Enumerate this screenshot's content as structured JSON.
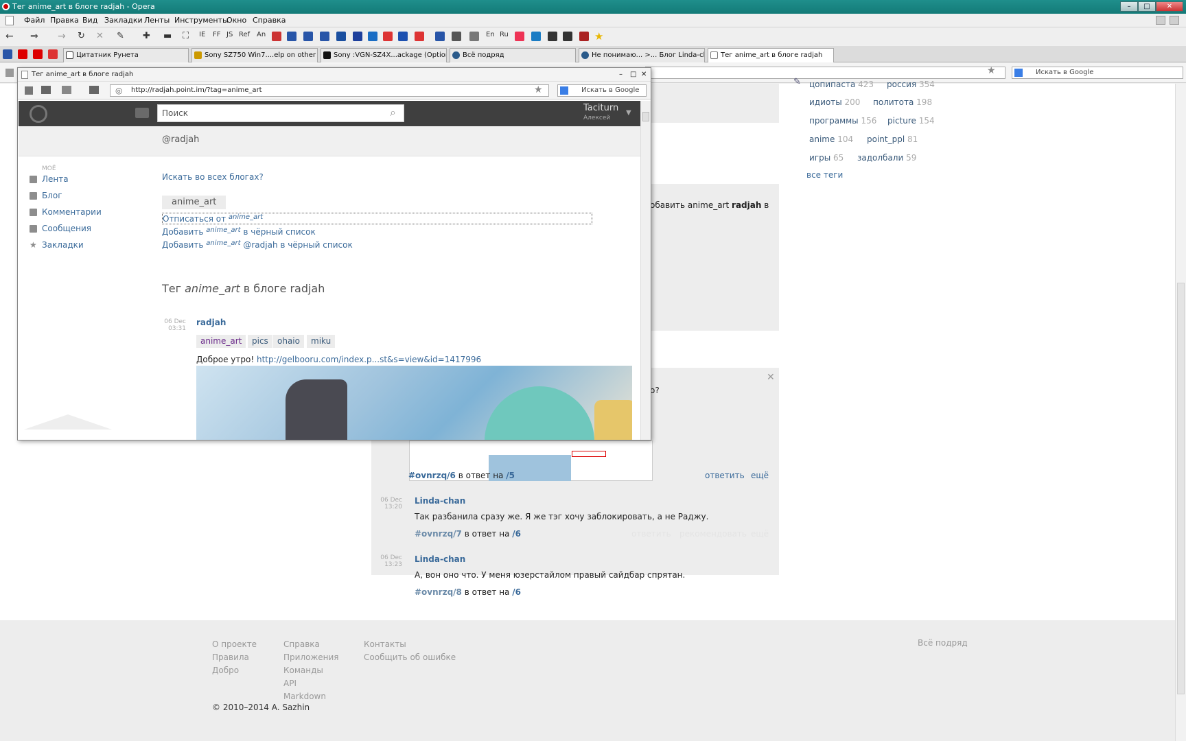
{
  "window": {
    "title": "Тег anime_art в блоге radjah - Opera"
  },
  "menu": [
    "Файл",
    "Правка",
    "Вид",
    "Закладки",
    "Ленты",
    "Инструменты",
    "Окно",
    "Справка"
  ],
  "toolbar": {
    "labels": [
      "IE",
      "FF",
      "JS",
      "Ref",
      "An",
      "En",
      "Ru"
    ]
  },
  "tabs": [
    {
      "label": "Цитатник Рунета"
    },
    {
      "label": "Sony SZ750 Win7....elp on other SZ's)"
    },
    {
      "label": "Sony :VGN-SZ4X...ackage (Optional)"
    },
    {
      "label": "Всё подряд"
    },
    {
      "label": "Не понимаю... >... Блог Linda-chan"
    },
    {
      "label": "Тег anime_art в блоге radjah"
    }
  ],
  "main_search": {
    "placeholder": "Искать в Google"
  },
  "right_tags": [
    {
      "name": "цопипаста",
      "count": "423"
    },
    {
      "name": "россия",
      "count": "354"
    },
    {
      "name": "идиоты",
      "count": "200"
    },
    {
      "name": "политота",
      "count": "198"
    },
    {
      "name": "программы",
      "count": "156"
    },
    {
      "name": "picture",
      "count": "154"
    },
    {
      "name": "anime",
      "count": "104"
    },
    {
      "name": "point_ppl",
      "count": "81"
    },
    {
      "name": "игры",
      "count": "65"
    },
    {
      "name": "задолбали",
      "count": "59"
    }
  ],
  "all_tags_label": "все теги",
  "behind": {
    "fragment_text": "обавить anime_art",
    "fragment_user": "radjah",
    "fragment_end": "в",
    "question_mark": "о?"
  },
  "comments": {
    "c6": {
      "id": "#ovnrzq/6",
      "in_reply": "в ответ на",
      "ref": "/5",
      "reply": "ответить",
      "more": "ещё"
    },
    "c7": {
      "date": "06 Dec",
      "time": "13:20",
      "author": "Linda-chan",
      "text": "Так разбанила сразу же. Я же тэг хочу заблокировать, а не Раджу.",
      "id": "#ovnrzq/7",
      "in_reply": "в ответ на",
      "ref": "/6",
      "reply": "ответить",
      "recommend": "рекомендовать",
      "more": "ещё"
    },
    "c8": {
      "date": "06 Dec",
      "time": "13:23",
      "author": "Linda-chan",
      "text": "А, вон оно что. У меня юзерстайлом правый сайдбар спрятан.",
      "id": "#ovnrzq/8",
      "in_reply": "в ответ на",
      "ref": "/6"
    }
  },
  "footer": {
    "col1": [
      "О проекте",
      "Правила",
      "Добро"
    ],
    "col2": [
      "Справка",
      "Приложения",
      "Команды",
      "API",
      "Markdown"
    ],
    "col3": [
      "Контакты",
      "Сообщить об ошибке"
    ],
    "right": "Всё подряд",
    "copyright": "© 2010–2014 A. Sazhin"
  },
  "popup": {
    "title": "Тег anime_art в блоге radjah",
    "url": "http://radjah.point.im/?tag=anime_art",
    "search_placeholder": "Искать в Google",
    "site_search_placeholder": "Поиск",
    "user": {
      "name": "Taciturn",
      "sub": "Алексей"
    },
    "blog_handle": "@radjah",
    "sidebar": {
      "heading": "моё",
      "items": [
        "Лента",
        "Блог",
        "Комментарии",
        "Сообщения",
        "Закладки"
      ]
    },
    "search_all": "Искать во всех блогах?",
    "tag_chip": "anime_art",
    "actions": {
      "unsubscribe_prefix": "Отписаться от",
      "tag": "anime_art",
      "add_prefix": "Добавить",
      "blacklist_suffix": "в чёрный список",
      "blacklist_user_suffix": "@radjah в чёрный список"
    },
    "heading": {
      "prefix": "Тег",
      "tag": "anime_art",
      "suffix": "в блоге radjah"
    },
    "post": {
      "date": "06 Dec",
      "time": "03:31",
      "author": "radjah",
      "tags": [
        "anime_art",
        "pics",
        "ohaio",
        "miku"
      ],
      "text": "Доброе утро!",
      "link": "http://gelbooru.com/index.p...st&s=view&id=1417996"
    }
  }
}
